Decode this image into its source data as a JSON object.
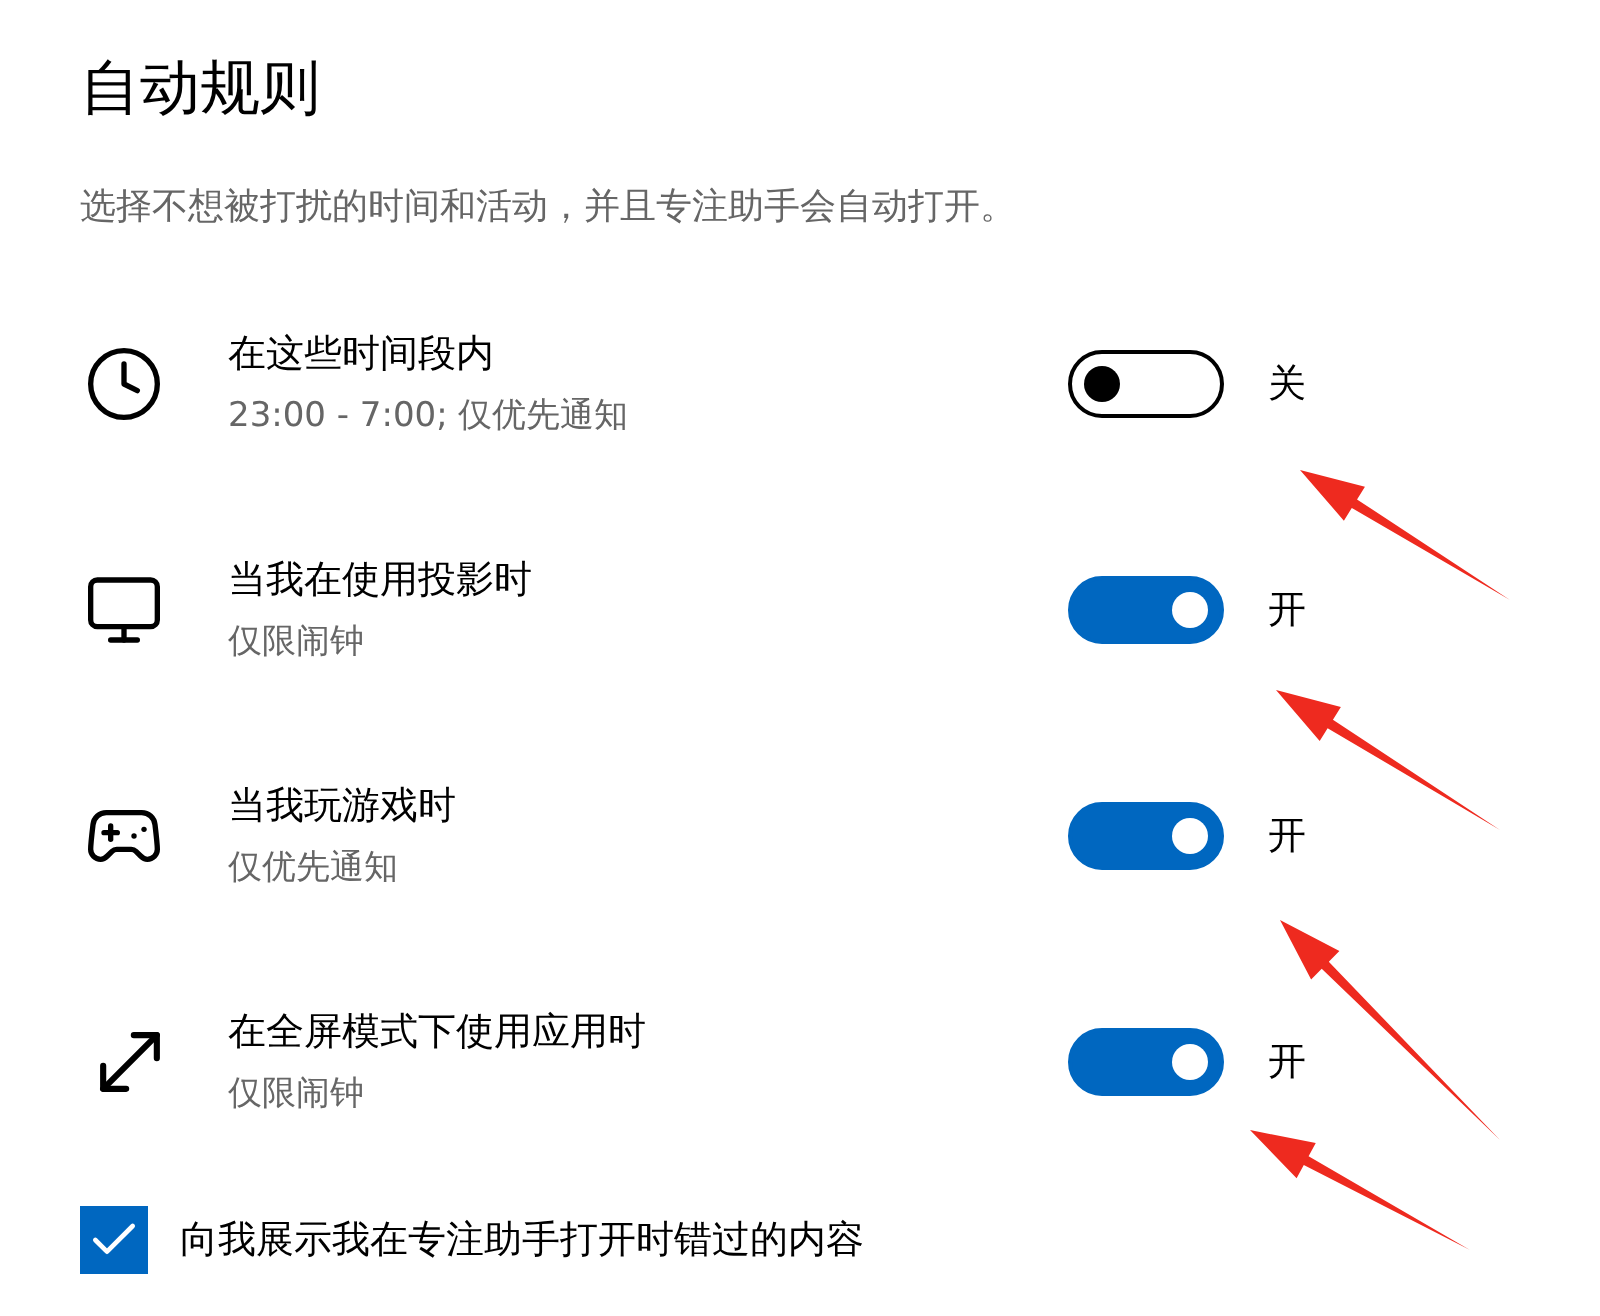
{
  "title": "自动规则",
  "description": "选择不想被打扰的时间和活动，并且专注助手会自动打开。",
  "rules": [
    {
      "kind": "clock",
      "name": "在这些时间段内",
      "detail": "23:00 - 7:00; 仅优先通知",
      "on": false,
      "state_label": "关"
    },
    {
      "kind": "monitor",
      "name": "当我在使用投影时",
      "detail": "仅限闹钟",
      "on": true,
      "state_label": "开"
    },
    {
      "kind": "gamepad",
      "name": "当我玩游戏时",
      "detail": "仅优先通知",
      "on": true,
      "state_label": "开"
    },
    {
      "kind": "fullscreen",
      "name": "在全屏模式下使用应用时",
      "detail": "仅限闹钟",
      "on": true,
      "state_label": "开"
    }
  ],
  "annotations": [
    {
      "kind": "arrow"
    },
    {
      "kind": "arrow"
    },
    {
      "kind": "arrow"
    },
    {
      "kind": "arrow"
    }
  ],
  "show_missed": {
    "label": "向我展示我在专注助手打开时错过的内容",
    "checked": true
  }
}
